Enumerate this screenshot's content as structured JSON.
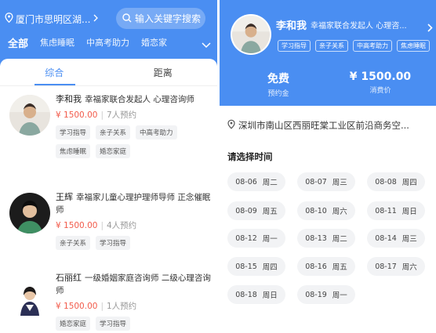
{
  "list_screen": {
    "location": "厦门市思明区湖...",
    "search_placeholder": "输入关键字搜索",
    "categories": [
      "全部",
      "焦虑睡眠",
      "中高考助力",
      "婚恋家"
    ],
    "sort_tabs": [
      "综合",
      "距离"
    ],
    "counselors": [
      {
        "name": "李和我",
        "title": "幸福家联合发起人 心理咨询师",
        "price": "¥ 1500.00",
        "bookings": "7人预约",
        "tags": [
          "学习指导",
          "亲子关系",
          "中高考助力",
          "焦虑睡眠",
          "婚恋家庭"
        ]
      },
      {
        "name": "王辉",
        "title": "幸福家儿童心理护理师导师 正念催眠师",
        "price": "¥ 1500.00",
        "bookings": "4人预约",
        "tags": [
          "亲子关系",
          "学习指导"
        ]
      },
      {
        "name": "石丽红",
        "title": "一级婚姻家庭咨询师 二级心理咨询师",
        "price": "¥ 1500.00",
        "bookings": "1人预约",
        "tags": [
          "婚恋家庭",
          "学习指导"
        ]
      }
    ]
  },
  "detail_screen": {
    "name": "李和我",
    "title": "幸福家联合发起人 心理咨...",
    "tags": [
      "学习指导",
      "亲子关系",
      "中高考助力",
      "焦虑睡眠"
    ],
    "stats": [
      {
        "value": "免费",
        "label": "预约金"
      },
      {
        "value": "¥ 1500.00",
        "label": "消费价"
      }
    ],
    "address": "深圳市南山区西丽旺棠工业区前沿商务空...",
    "time_section_title": "请选择时间",
    "time_slots": [
      {
        "date": "08-06",
        "weekday": "周二"
      },
      {
        "date": "08-07",
        "weekday": "周三"
      },
      {
        "date": "08-08",
        "weekday": "周四"
      },
      {
        "date": "08-09",
        "weekday": "周五"
      },
      {
        "date": "08-10",
        "weekday": "周六"
      },
      {
        "date": "08-11",
        "weekday": "周日"
      },
      {
        "date": "08-12",
        "weekday": "周一"
      },
      {
        "date": "08-13",
        "weekday": "周二"
      },
      {
        "date": "08-14",
        "weekday": "周三"
      },
      {
        "date": "08-15",
        "weekday": "周四"
      },
      {
        "date": "08-16",
        "weekday": "周五"
      },
      {
        "date": "08-17",
        "weekday": "周六"
      },
      {
        "date": "08-18",
        "weekday": "周日"
      },
      {
        "date": "08-19",
        "weekday": "周一"
      }
    ]
  },
  "colors": {
    "primary": "#4a8ef2",
    "price": "#f25b4b",
    "chip_bg": "#f2f3f5"
  }
}
